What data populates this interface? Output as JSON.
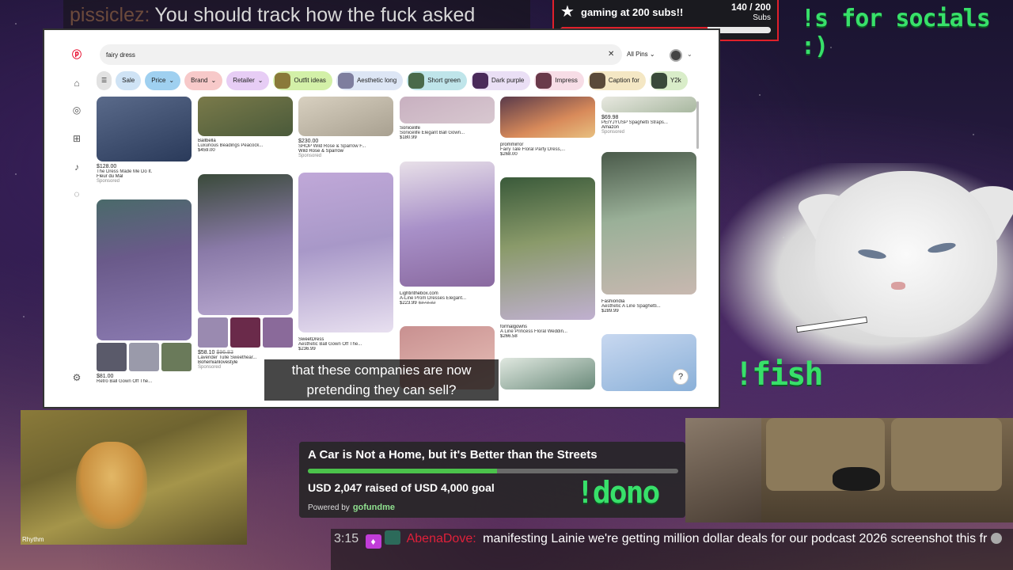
{
  "top_chat": {
    "user": "pissiclez:",
    "message": "You should track how the fuck asked"
  },
  "sub_goal": {
    "label": "gaming at 200 subs!!",
    "count": "140 / 200",
    "unit": "Subs",
    "progress": 0.7
  },
  "socials_cmd": "!s for socials :)",
  "fish_cmd": "!fish",
  "dono_cmd": "!dono",
  "pinterest": {
    "search_value": "fairy dress",
    "filter_label": "All Pins",
    "chips": [
      {
        "label": "Sale",
        "color": "#cfe3f5"
      },
      {
        "label": "Price",
        "color": "#9fd0f0",
        "dropdown": true
      },
      {
        "label": "Brand",
        "color": "#f7c9c9",
        "dropdown": true
      },
      {
        "label": "Retailer",
        "color": "#e7cdf5",
        "dropdown": true
      },
      {
        "label": "Outfit ideas",
        "color": "#d3f0a8",
        "thumb": "#8a7a3a"
      },
      {
        "label": "Aesthetic long",
        "color": "#dde6f5",
        "thumb": "#7e7e9e"
      },
      {
        "label": "Short green",
        "color": "#bfe5ea",
        "thumb": "#4a6a4a"
      },
      {
        "label": "Dark purple",
        "color": "#eadff5",
        "thumb": "#4a2a5a"
      },
      {
        "label": "Impress",
        "color": "#f7dde6",
        "thumb": "#6a3a4a"
      },
      {
        "label": "Caption for",
        "color": "#f4e7c4",
        "thumb": "#5a4a3a"
      },
      {
        "label": "Y2k",
        "color": "#d9edc9",
        "thumb": "#3a4a3a"
      }
    ],
    "pins": [
      {
        "price": "$128.00",
        "title": "The Dress Made Me Do It.",
        "src": "Fleur du Mal",
        "spons": "Sponsored"
      },
      {
        "src": "Ballbella",
        "title": "Luxurious Beadings Peacock...",
        "price": "$459.00"
      },
      {
        "price": "$230.00",
        "title": "SHOP Wild Rose & Sparrow F...",
        "src": "Wild Rose & Sparrow",
        "spons": "Sponsored"
      },
      {
        "src": "Sonicelife",
        "title": "Sonicelife Elegant Ball Gown...",
        "price": "$180.99"
      },
      {
        "src": "prommirror",
        "title": "Fairy Tale Floral Party Dress,...",
        "price": "$268.00"
      },
      {
        "price": "$69.98",
        "title": "PEIYJYUSP Spaghetti Straps...",
        "src": "Amazon",
        "spons": "Sponsored"
      },
      {
        "price": "$58.10",
        "old": "$96.83",
        "title": "Lavender Tulle Sweethear...",
        "src": "Bohemianlovestyle",
        "spons": "Sponsored"
      },
      {
        "src": "SweetDress",
        "title": "Aesthetic Ball Gown Off The...",
        "price": "$236.99"
      },
      {
        "src": "Lightinthebox.com",
        "title": "A-Line Prom Dresses Elegant...",
        "price": "$223.99",
        "old": "$373.32"
      },
      {
        "src": "formalgowns",
        "title": "A Line Princess Floral Weddin...",
        "price": "$266.58"
      },
      {
        "src": "Fashiondia",
        "title": "Aesthetic A Line Spaghetti...",
        "price": "$289.99"
      },
      {
        "price": "$81.00",
        "title": "Retro Ball Gown Off The..."
      }
    ]
  },
  "caption": "that these companies are now pretending they can sell?",
  "donation": {
    "title": "A Car is Not a Home, but it's Better than the Streets",
    "raised": "USD 2,047 raised of USD 4,000 goal",
    "progress": 0.51,
    "powered_by": "Powered by",
    "brand": "gofundme"
  },
  "lion_logo": "Rhythm",
  "bottom_chat": {
    "time": "3:15",
    "user": "AbenaDove:",
    "message": "manifesting Lainie we're getting million dollar deals for our podcast 2026 screenshot this fr"
  }
}
